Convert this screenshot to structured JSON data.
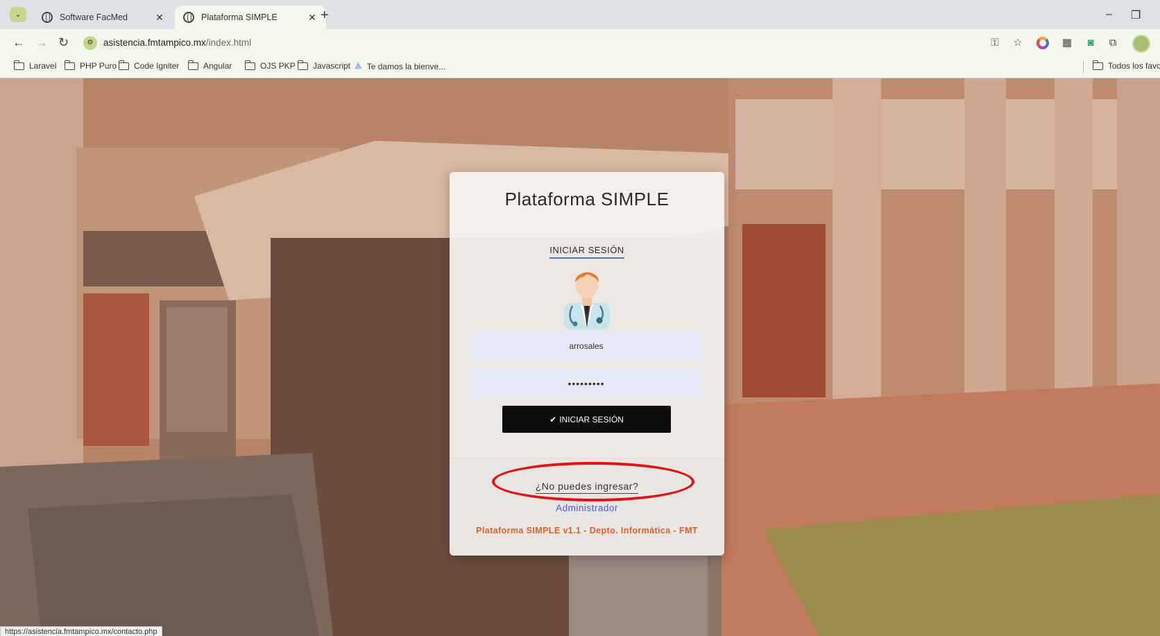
{
  "browser": {
    "tabs": [
      {
        "title": "Software FacMed",
        "active": false
      },
      {
        "title": "Plataforma SIMPLE",
        "active": true
      }
    ],
    "url_host": "asistencia.fmtampico.mx",
    "url_path": "/index.html",
    "bookmarks": [
      "Laravel",
      "PHP Puro",
      "Code Igniter",
      "Angular",
      "OJS PKP",
      "Javascript",
      "Te damos la bienve..."
    ],
    "all_bookmarks_label": "Todos los favori",
    "status_url": "https://asistencia.fmtampico.mx/contacto.php"
  },
  "login": {
    "title": "Plataforma SIMPLE",
    "section": "INICIAR SESIÓN",
    "username_value": "arrosales",
    "password_mask": "•••••••••",
    "submit_label": "INICIAR SESIÓN",
    "help_link": "¿No puedes ingresar?",
    "admin_link": "Administrador",
    "credit": "Plataforma SIMPLE v1.1 - Depto. Informática - FMT"
  },
  "colors": {
    "accent_red": "#e11414",
    "credit_orange": "#d1632e",
    "link_blue": "#4a57d6"
  }
}
